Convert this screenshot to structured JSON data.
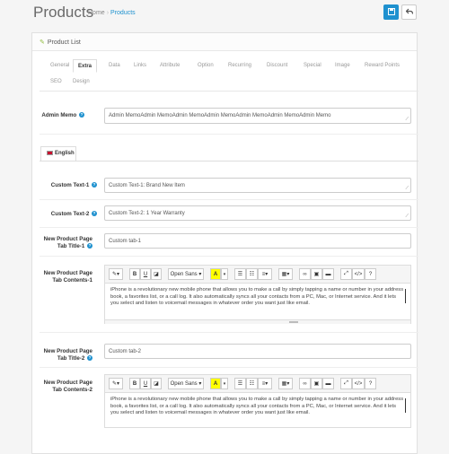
{
  "header": {
    "title": "Products",
    "breadcrumb": [
      "Home",
      "Products"
    ],
    "save_icon": "save-icon",
    "back_icon": "reply-icon"
  },
  "panel": {
    "title": "Product List",
    "title_icon": "pencil-icon"
  },
  "tabs": [
    "General",
    "Extra",
    "Data",
    "Links",
    "Attribute",
    "Option",
    "Recurring",
    "Discount",
    "Special",
    "Image",
    "Reward Points",
    "SEO",
    "Design"
  ],
  "active_tab": "Extra",
  "admin_memo": {
    "label": "Admin Memo",
    "value": "Admin MemoAdmin MemoAdmin MemoAdmin MemoAdmin MemoAdmin MemoAdmin Memo"
  },
  "language_tab": "English",
  "custom_text_1": {
    "label": "Custom Text-1",
    "value": "Custom Text-1: Brand New Item"
  },
  "custom_text_2": {
    "label": "Custom Text-2",
    "value": "Custom Text-2: 1 Year Warranty"
  },
  "tab_title_1": {
    "label_line1": "New Product Page",
    "label_line2": "Tab Title-1",
    "value": "Custom tab-1"
  },
  "tab_contents_1": {
    "label_line1": "New Product Page",
    "label_line2": "Tab Contents-1",
    "text": "iPhone is a revolutionary new mobile phone that allows you to make a call by simply tapping a name or number in your address book, a favorites list, or a call log. It also automatically syncs all your contacts from a PC, Mac, or Internet service. And it lets you select and listen to voicemail messages in whatever order you want just like email."
  },
  "tab_title_2": {
    "label_line1": "New Product Page",
    "label_line2": "Tab Title-2",
    "value": "Custom tab-2"
  },
  "tab_contents_2": {
    "label_line1": "New Product Page",
    "label_line2": "Tab Contents-2",
    "text": "iPhone is a revolutionary new mobile phone that allows you to make a call by simply tapping a name or number in your address book, a favorites list, or a call log. It also automatically syncs all your contacts from a PC, Mac, or Internet service. And it lets you select and listen to voicemail messages in whatever order you want just like email."
  },
  "editor_toolbar": {
    "font_name": "Open Sans",
    "bold": "B",
    "underline": "U",
    "font_color": "A",
    "code_view": "</>",
    "help": "?"
  },
  "colors": {
    "primary": "#1e91cf",
    "pencil": "#8fbb3c",
    "font_color_highlight": "#ffff00"
  }
}
